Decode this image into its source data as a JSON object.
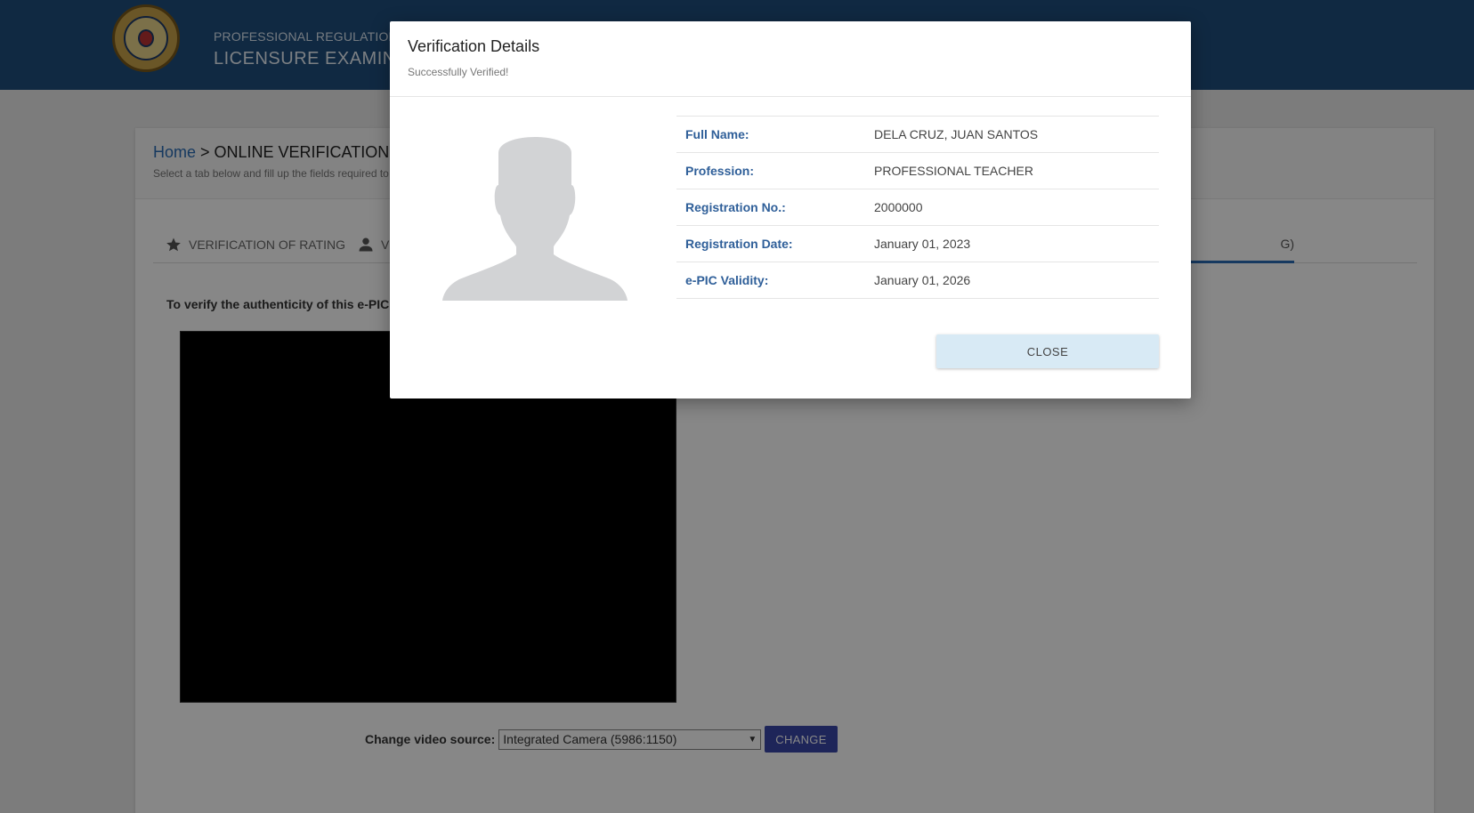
{
  "header": {
    "subtitle": "PROFESSIONAL REGULATION C",
    "title": "LICENSURE EXAMINAT"
  },
  "breadcrumb": {
    "home": "Home",
    "separator": " > ",
    "current": "ONLINE VERIFICATION",
    "description": "Select a tab below and fill up the fields required to"
  },
  "tabs": [
    {
      "label": "VERIFICATION OF RATING",
      "icon": "star-icon"
    },
    {
      "label": "V",
      "icon": "person-icon"
    },
    {
      "label": "G)",
      "icon": ""
    }
  ],
  "main": {
    "instruction": "To verify the authenticity of this e-PIC, k",
    "video_source_label": "Change video source:",
    "video_source_value": "Integrated Camera (5986:1150)",
    "change_button": "CHANGE"
  },
  "modal": {
    "title": "Verification Details",
    "subtitle": "Successfully Verified!",
    "details": [
      {
        "label": "Full Name:",
        "value": "DELA CRUZ, JUAN SANTOS"
      },
      {
        "label": "Profession:",
        "value": "PROFESSIONAL TEACHER"
      },
      {
        "label": "Registration No.:",
        "value": "2000000"
      },
      {
        "label": "Registration Date:",
        "value": "January 01, 2023"
      },
      {
        "label": "e-PIC Validity:",
        "value": "January 01, 2026"
      }
    ],
    "close_button": "CLOSE"
  },
  "colors": {
    "header_bg": "#1f4f7e",
    "link_blue": "#2a6db5",
    "label_blue": "#2f5f99",
    "change_button_bg": "#3a46a8",
    "close_button_bg": "#d8eaf5"
  }
}
